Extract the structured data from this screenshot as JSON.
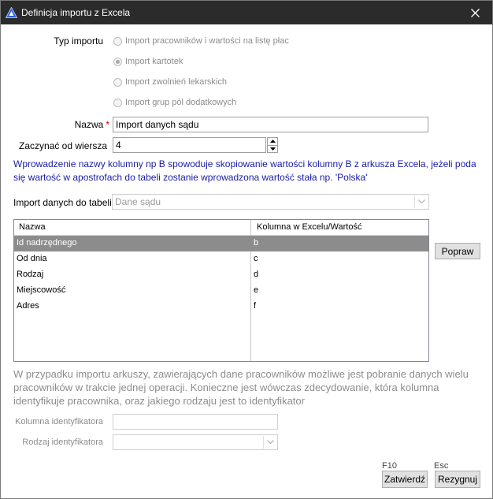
{
  "window": {
    "title": "Definicja importu z Excela",
    "titlebar_color": "#2b2b2b"
  },
  "import_type": {
    "label": "Typ importu",
    "options": [
      {
        "label": "Import pracowników i wartości na listę płac",
        "checked": false
      },
      {
        "label": "Import kartotek",
        "checked": true
      },
      {
        "label": "Import zwolnień lekarskich",
        "checked": false
      },
      {
        "label": "Import grup pól dodatkowych",
        "checked": false
      }
    ]
  },
  "name": {
    "label": "Nazwa",
    "required_mark": "*",
    "value": "Import danych sądu"
  },
  "start_row": {
    "label": "Zaczynać od wiersza",
    "value": "4"
  },
  "info_text": "Wprowadzenie nazwy kolumny np B spowoduje skopiowanie wartości kolumny B z arkusza Excela, jeżeli poda się wartość w apostrofach do tabeli zostanie wprowadzona wartość stała np. 'Polska'",
  "info_color": "#1a1aa6",
  "target_table": {
    "label": "Import danych do tabeli",
    "value": "Dane sądu"
  },
  "grid": {
    "columns": [
      "Nazwa",
      "Kolumna w Excelu/Wartość"
    ],
    "rows": [
      {
        "name": "Id nadrzędnego",
        "value": "b",
        "selected": true
      },
      {
        "name": "Od dnia",
        "value": "c",
        "selected": false
      },
      {
        "name": "Rodzaj",
        "value": "d",
        "selected": false
      },
      {
        "name": "Miejscowość",
        "value": "e",
        "selected": false
      },
      {
        "name": "Adres",
        "value": "f",
        "selected": false
      }
    ],
    "selection_color": "#8c8c8c"
  },
  "correct_button": {
    "label": "Popraw"
  },
  "identifier_note": "W przypadku importu arkuszy, zawierających dane pracowników możliwe jest pobranie danych wielu pracowników w trakcie jednej operacji. Konieczne jest wówczas zdecydowanie, która kolumna identyfikuje pracownika, oraz jakiego rodzaju jest to identyfikator",
  "identifier_column": {
    "label": "Kolumna identyfikatora",
    "value": ""
  },
  "identifier_type": {
    "label": "Rodzaj identyfikatora",
    "value": ""
  },
  "footer": {
    "confirm": {
      "hint": "F10",
      "label": "Zatwierdź"
    },
    "cancel": {
      "hint": "Esc",
      "label": "Rezygnuj"
    }
  },
  "icons": {
    "app": "triangle-logo-icon",
    "close": "close-icon",
    "spin_up": "spin-up-icon",
    "spin_down": "spin-down-icon",
    "dropdown": "chevron-down-icon"
  }
}
